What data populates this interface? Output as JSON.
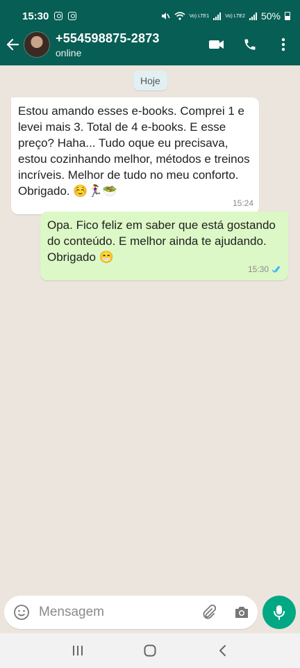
{
  "status_bar": {
    "time": "15:30",
    "lte1": "Vo) LTE1",
    "lte2": "Vo) LTE2",
    "battery": "50%"
  },
  "header": {
    "contact_name": "+554598875-2873",
    "presence": "online"
  },
  "chat": {
    "date_label": "Hoje",
    "messages": [
      {
        "direction": "in",
        "text": "Estou amando esses e-books. Comprei 1 e levei mais 3. Total de 4 e-books. E esse preço? Haha... Tudo oque eu precisava, estou cozinhando melhor, métodos e treinos incríveis. Melhor de tudo no meu conforto. Obrigado. ☺️🏃‍♀️🥗",
        "time": "15:24"
      },
      {
        "direction": "out",
        "text": "Opa. Fico feliz em saber que está gostando do conteúdo. E melhor ainda te ajudando. Obrigado 😁",
        "time": "15:30",
        "status": "read"
      }
    ]
  },
  "composer": {
    "placeholder": "Mensagem"
  },
  "colors": {
    "header": "#075e54",
    "chat_bg": "#ece5dd",
    "out_bubble": "#dcf8c6",
    "in_bubble": "#ffffff",
    "mic_button": "#00a884",
    "read_ticks": "#34b7f1"
  },
  "icons": [
    "back-arrow-icon",
    "video-call-icon",
    "phone-icon",
    "more-options-icon",
    "emoji-icon",
    "attach-icon",
    "camera-icon",
    "mic-icon",
    "recents-icon",
    "home-icon",
    "back-nav-icon"
  ]
}
